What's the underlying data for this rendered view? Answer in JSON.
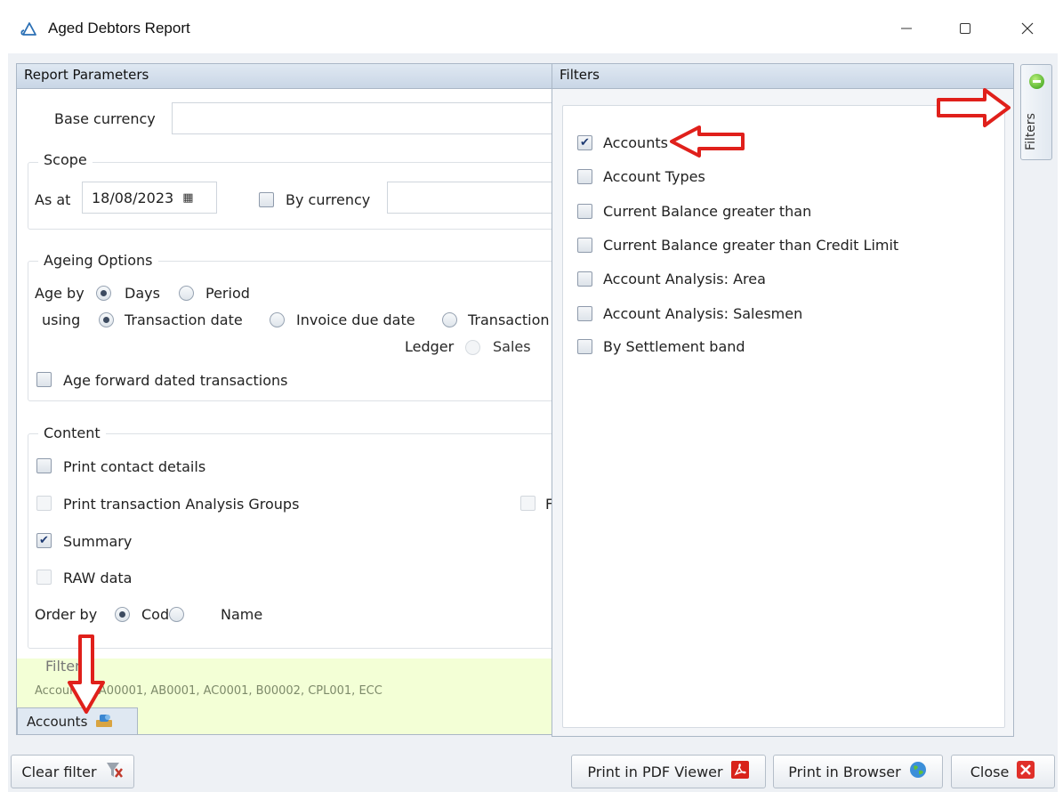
{
  "window": {
    "title": "Aged Debtors Report",
    "minimize_glyph": "—",
    "maximize_glyph": "☐",
    "close_glyph": "✕",
    "icon": "app-cloud-icon"
  },
  "report_parameters": {
    "header": "Report Parameters",
    "base_currency": {
      "label": "Base currency",
      "value": ""
    },
    "scope": {
      "title": "Scope",
      "as_at_label": "As at",
      "as_at_value": "18/08/2023",
      "calendar_glyph": "▦",
      "by_currency_label": "By currency",
      "by_currency_checked": false,
      "currency_value": ""
    },
    "ageing_options": {
      "title": "Ageing Options",
      "age_by_label": "Age by",
      "age_by_options": [
        "Days",
        "Period"
      ],
      "age_by_selected": "Days",
      "using_label": "using",
      "using_options": [
        "Transaction date",
        "Invoice due date",
        "Transaction"
      ],
      "using_selected": "Transaction date",
      "ledger_label": "Ledger",
      "ledger_option": "Sales",
      "age_forward_label": "Age forward dated transactions",
      "age_forward_checked": false
    },
    "content": {
      "title": "Content",
      "print_contact_details": {
        "label": "Print contact details",
        "checked": false
      },
      "print_transaction_analysis_groups": {
        "label": "Print transaction Analysis Groups",
        "checked": false,
        "enabled": false
      },
      "truncated_right_label": "F",
      "summary": {
        "label": "Summary",
        "checked": true
      },
      "raw_data": {
        "label": "RAW data",
        "checked": false,
        "enabled": false
      },
      "order_by_label": "Order by",
      "order_by_options": [
        "Code",
        "Name"
      ],
      "order_by_selected": "Code"
    },
    "filter": {
      "title": "Filter",
      "summary_line": "Accounts :  A00001, AB0001, AC0001, B00002, CPL001, ECC",
      "tab_label": "Accounts"
    }
  },
  "filters": {
    "header": "Filters",
    "items": [
      {
        "label": "Accounts",
        "checked": true
      },
      {
        "label": "Account Types",
        "checked": false
      },
      {
        "label": "Current Balance greater than",
        "checked": false
      },
      {
        "label": "Current Balance greater than Credit Limit",
        "checked": false
      },
      {
        "label": "Account Analysis:  Area",
        "checked": false
      },
      {
        "label": "Account Analysis:  Salesmen",
        "checked": false
      },
      {
        "label": "By Settlement band",
        "checked": false
      }
    ],
    "side_tab_label": "Filters"
  },
  "buttons": {
    "clear_filter": "Clear filter",
    "print_pdf": "Print in PDF Viewer",
    "print_browser": "Print in Browser",
    "close": "Close"
  },
  "colors": {
    "annotation_red": "#e0201b",
    "panel_header": "#d3deeb",
    "filter_bg": "#f3ffd6"
  }
}
